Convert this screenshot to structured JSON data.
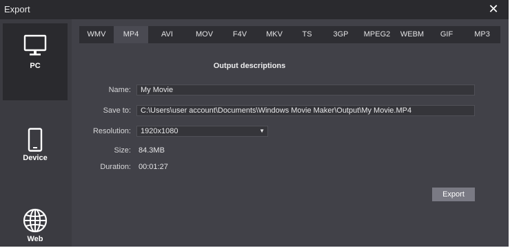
{
  "window": {
    "title": "Export",
    "close_icon": "close-icon"
  },
  "sidebar": {
    "items": [
      {
        "label": "PC",
        "icon": "monitor-icon",
        "active": true
      },
      {
        "label": "Device",
        "icon": "phone-icon",
        "active": false
      },
      {
        "label": "Web",
        "icon": "globe-icon",
        "active": false
      }
    ]
  },
  "format_tabs": [
    "WMV",
    "MP4",
    "AVI",
    "MOV",
    "F4V",
    "MKV",
    "TS",
    "3GP",
    "MPEG2",
    "WEBM",
    "GIF",
    "MP3"
  ],
  "selected_format": "MP4",
  "output": {
    "heading": "Output descriptions",
    "name_label": "Name:",
    "name_value": "My Movie",
    "save_label": "Save to:",
    "save_value": "C:\\Users\\user account\\Documents\\Windows Movie Maker\\Output\\My Movie.MP4",
    "resolution_label": "Resolution:",
    "resolution_value": "1920x1080",
    "size_label": "Size:",
    "size_value": "84.3MB",
    "duration_label": "Duration:",
    "duration_value": "00:01:27"
  },
  "buttons": {
    "export_label": "Export"
  },
  "colors": {
    "window_bg": "#414148",
    "titlebar_bg": "#2a2a2e",
    "tabbar_bg": "#2e2e33",
    "active_tab_bg": "#4a4a52",
    "button_bg": "#7a7a84"
  }
}
